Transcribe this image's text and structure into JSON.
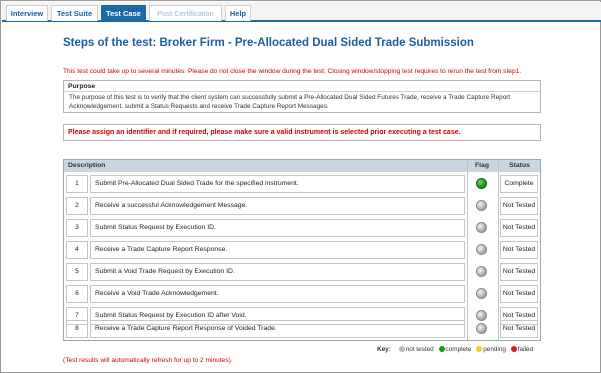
{
  "tabs": [
    {
      "label": "Interview",
      "state": "normal"
    },
    {
      "label": "Test Suite",
      "state": "normal"
    },
    {
      "label": "Test Case",
      "state": "active"
    },
    {
      "label": "Post Certification",
      "state": "disabled"
    },
    {
      "label": "Help",
      "state": "normal"
    }
  ],
  "page": {
    "title": "Steps of the test: Broker Firm - Pre-Allocated Dual Sided Trade Submission",
    "warning": "This test could take up to several minutes. Please do not close the window during the test. Closing window/stopping test requires to rerun the test from step1."
  },
  "purpose": {
    "heading": "Purpose",
    "text": "The purpose of this test is to verify that the client system can successfully submit a Pre-Allocated Dual Sided Futures Trade, receive a Trade Capture Report Acknowledgement, submit a Status Requests and receive Trade Capture Report Messages."
  },
  "assign_notice": "Please assign an identifier and if required, please make sure a valid instrument is selected prior executing a test case.",
  "table": {
    "headers": {
      "description": "Description",
      "flag": "Flag",
      "status": "Status"
    },
    "rows": [
      {
        "num": "1",
        "description": "Submit Pre-Allocated Dual Sided Trade for the specified instrument.",
        "flag": "complete",
        "status": "Complete"
      },
      {
        "num": "2",
        "description": "Receive a successful Acknowledgement Message.",
        "flag": "not tested",
        "status": "Not Tested"
      },
      {
        "num": "3",
        "description": "Submit Status Request by Execution ID.",
        "flag": "not tested",
        "status": "Not Tested"
      },
      {
        "num": "4",
        "description": "Receive a Trade Capture Report Response.",
        "flag": "not tested",
        "status": "Not Tested"
      },
      {
        "num": "5",
        "description": "Submit a Void Trade Request by Execution ID.",
        "flag": "not tested",
        "status": "Not Tested"
      },
      {
        "num": "6",
        "description": "Receive a Void Trade Acknowledgement.",
        "flag": "not tested",
        "status": "Not Tested"
      },
      {
        "num": "7",
        "description": "Submit Status Request by Execution ID after Void.",
        "flag": "not tested",
        "status": "Not Tested"
      },
      {
        "num": "8",
        "description": "Receive a Trade Capture Report Response of Voided Trade.",
        "flag": "not tested",
        "status": "Not Tested"
      }
    ]
  },
  "key": {
    "label": "Key:",
    "not_tested": "not tested",
    "complete": "complete",
    "pending": "pending",
    "failed": "failed"
  },
  "refresh_note": "(Test results will automatically refresh for up to 2 minutes).",
  "colors": {
    "accent": "#1b6aa8",
    "warning": "#cc0000",
    "complete": "#1a9a1a",
    "pending": "#f0d020",
    "failed": "#d02020",
    "not_tested": "#bdbdbd"
  }
}
